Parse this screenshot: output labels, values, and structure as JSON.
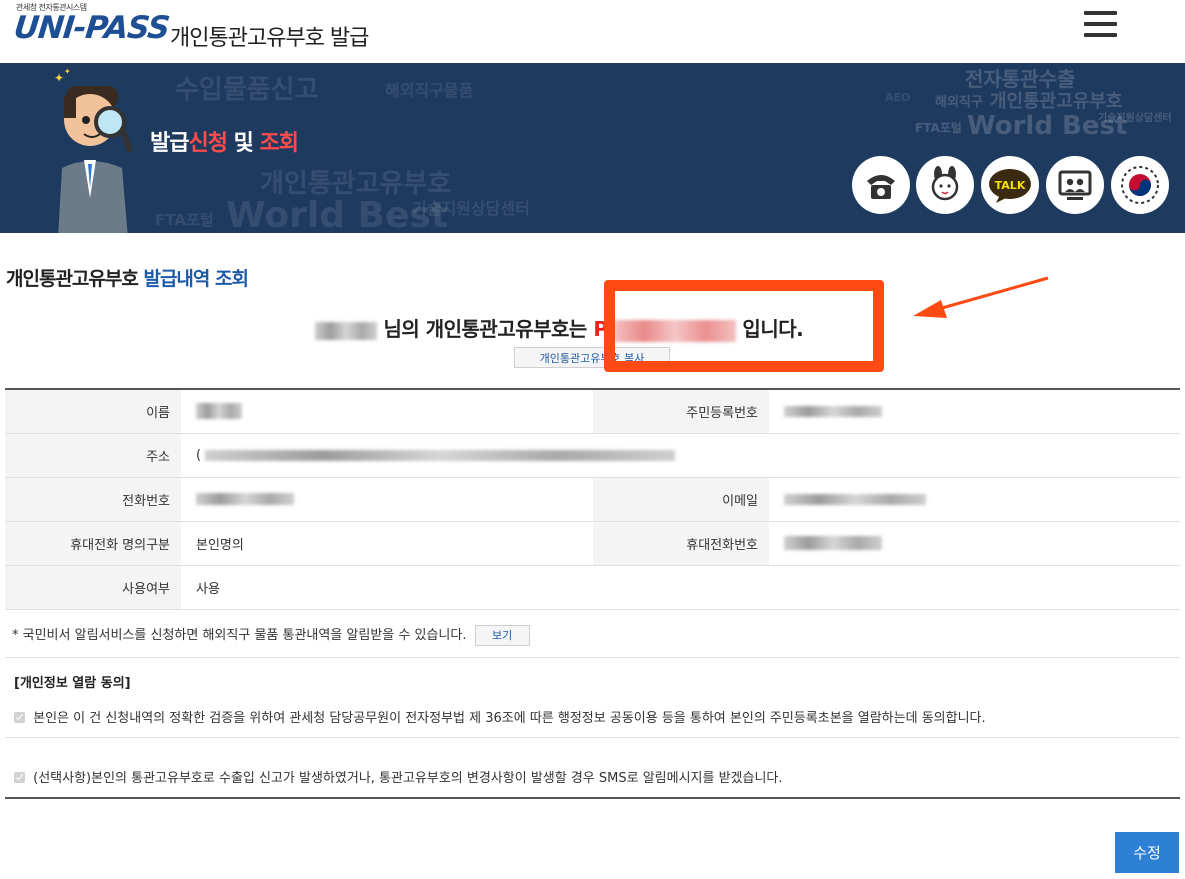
{
  "header": {
    "logo_small": "관세청 전자통관시스템",
    "logo_main": "UNI-PASS",
    "title": "개인통관고유부호 발급",
    "menu_icon": "hamburger-menu-icon"
  },
  "banner": {
    "title_part1": "발급",
    "title_part2": "신청",
    "title_part3": " 및 ",
    "title_part4": "조회",
    "bg_words": [
      "수입물품신고",
      "해외직구물품",
      "개인통관고유부호",
      "World Best",
      "기술지원상담센터",
      "FTA포털",
      "전자통관수출",
      "해외직구",
      "개인통관고유부호",
      "FTA포털",
      "World Best",
      "기술지원상담센터",
      "AEO"
    ],
    "service_icons": [
      "phone-icon",
      "mascot-icon",
      "talk-icon",
      "video-consult-icon",
      "government-emblem-icon"
    ],
    "talk_label": "TALK",
    "colors": {
      "background": "#1f3a5f",
      "accent_red": "#ff4b4b"
    }
  },
  "content": {
    "section_title_part1": "개인통관고유부호 ",
    "section_title_part2": "발급내역 조회",
    "result_middle": "님의 개인통관고유부호는",
    "result_code_prefix": "P",
    "result_end": "입니다.",
    "copy_button": "개인통관고유부호 복사",
    "highlight_color": "#ff4a14"
  },
  "table": {
    "name_label": "이름",
    "rrn_label": "주민등록번호",
    "address_label": "주소",
    "address_prefix": "(",
    "phone_label": "전화번호",
    "email_label": "이메일",
    "mobile_type_label": "휴대전화 명의구분",
    "mobile_type_value": "본인명의",
    "mobile_label": "휴대전화번호",
    "use_label": "사용여부",
    "use_value": "사용"
  },
  "notice": {
    "text": "* 국민비서 알림서비스를 신청하면 해외직구 물품 통관내역을 알림받을 수 있습니다.",
    "view_button": "보기"
  },
  "consent": {
    "title": "[개인정보 열람 동의]",
    "item1": "본인은 이 건 신청내역의 정확한 검증을 위하여 관세청 담당공무원이 전자정부법 제 36조에 따른 행정정보 공동이용 등을 통하여 본인의 주민등록초본을 열람하는데 동의합니다.",
    "item2": "(선택사항)본인의 통관고유부호로 수출입 신고가 발생하였거나, 통관고유부호의 변경사항이 발생할 경우 SMS로 알림메시지를 받겠습니다.",
    "item1_checked": true,
    "item2_checked": true
  },
  "actions": {
    "submit_button": "수정",
    "submit_color": "#2d80d6"
  }
}
